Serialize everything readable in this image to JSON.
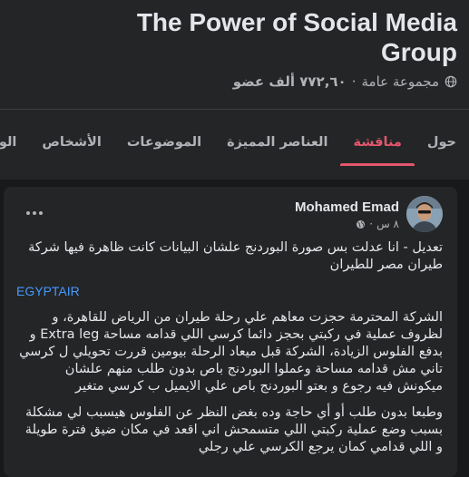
{
  "group": {
    "title": "The Power of Social Media Group",
    "privacy": "مجموعة عامة",
    "separator": "·",
    "members": "٧٧٢,٦٠ ألف عضو"
  },
  "tabs": [
    {
      "label": "حول"
    },
    {
      "label": "مناقشة",
      "active": true
    },
    {
      "label": "العناصر المميزة"
    },
    {
      "label": "الموضوعات"
    },
    {
      "label": "الأشخاص"
    },
    {
      "label": "الوسا"
    }
  ],
  "post": {
    "author": "Mohamed Emad",
    "time": "٨ س",
    "time_separator": "·",
    "paragraphs": [
      "تعديل - انا عدلت بس صورة البوردنج علشان البيانات كانت ظاهرة فيها شركة طيران مصر للطيران",
      "الشركة المحترمة حجزت معاهم علي رحلة طيران من الرياض للقاهرة، و لظروف عملية في ركبتي بحجز دائما كرسي اللي قدامه مساحة Extra leg و بدفع الفلوس الزيادة، الشركة قبل ميعاد الرحلة بيومين قررت تحويلي ل كرسي تاني مش قدامه مساحة  وعملوا البوردنج باص بدون طلب منهم علشان ميكونش فيه رجوع و بعتو البوردنج باص علي الايميل ب كرسي متغير",
      "وطبعا بدون طلب أو أي حاجة وده بغض النظر عن الفلوس هيسبب لي مشكلة بسبب وضع عملية ركبتي اللي متسمحش اني اقعد في مكان ضيق فترة طويلة و اللي قدامي كمان يرجع الكرسي علي رجلي"
    ],
    "tag": "EGYPTAIR"
  },
  "colors": {
    "background": "#18191a",
    "card": "#242526",
    "accent": "#e4566d",
    "link": "#4599ff"
  }
}
